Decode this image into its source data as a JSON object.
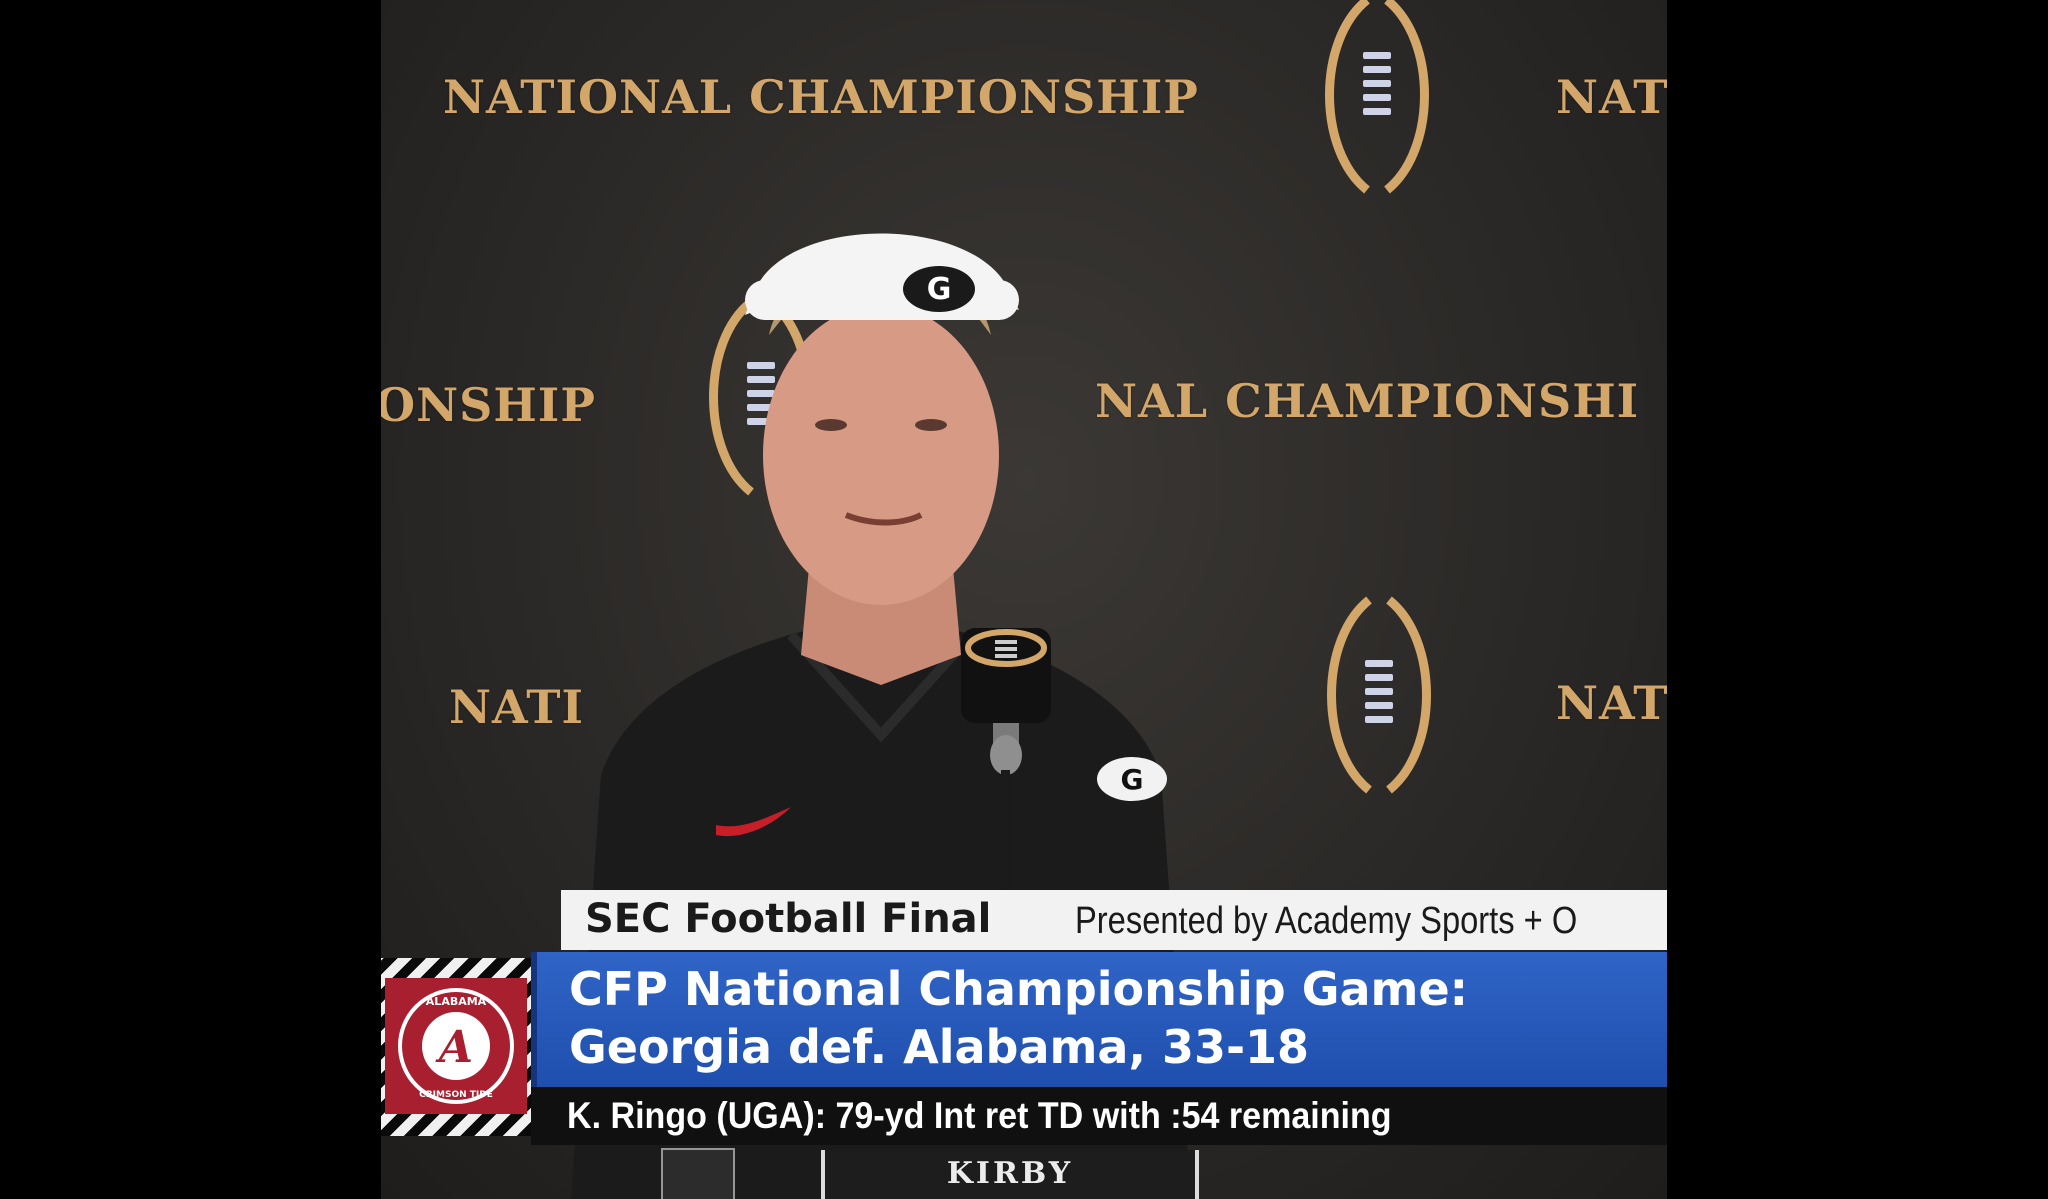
{
  "backdrop": {
    "wordmark": "NATIONAL CHAMPIONSHIP",
    "wordmark_fragment_1": "NATI",
    "wordmark_fragment_2": "ONSHIP",
    "wordmark_fragment_3": "NAL CHAMPIONSHI",
    "wordmark_fragment_4": "NATI",
    "wordmark_fragment_5": "NATI"
  },
  "colors": {
    "gold": "#d3a66a",
    "headline_blue": "#2f64c6",
    "alabama_crimson": "#a8202f",
    "georgia_red": "#ba0c2f"
  },
  "speaker": {
    "visor_logo": "G",
    "shirt_logo": "G"
  },
  "lower_third": {
    "show_name": "SEC Football Final",
    "sponsor": "Presented by Academy Sports + O",
    "headline_line_1": "CFP National Championship Game:",
    "headline_line_2": "Georgia def. Alabama, 33-18",
    "ticker": "K. Ringo (UGA): 79-yd Int ret TD with :54 remaining",
    "team_logo": {
      "icon": "alabama-crimson-tide-logo",
      "text": "ALABAMA CRIMSON TIDE"
    }
  },
  "table": {
    "nameplate": "KIRBY"
  }
}
